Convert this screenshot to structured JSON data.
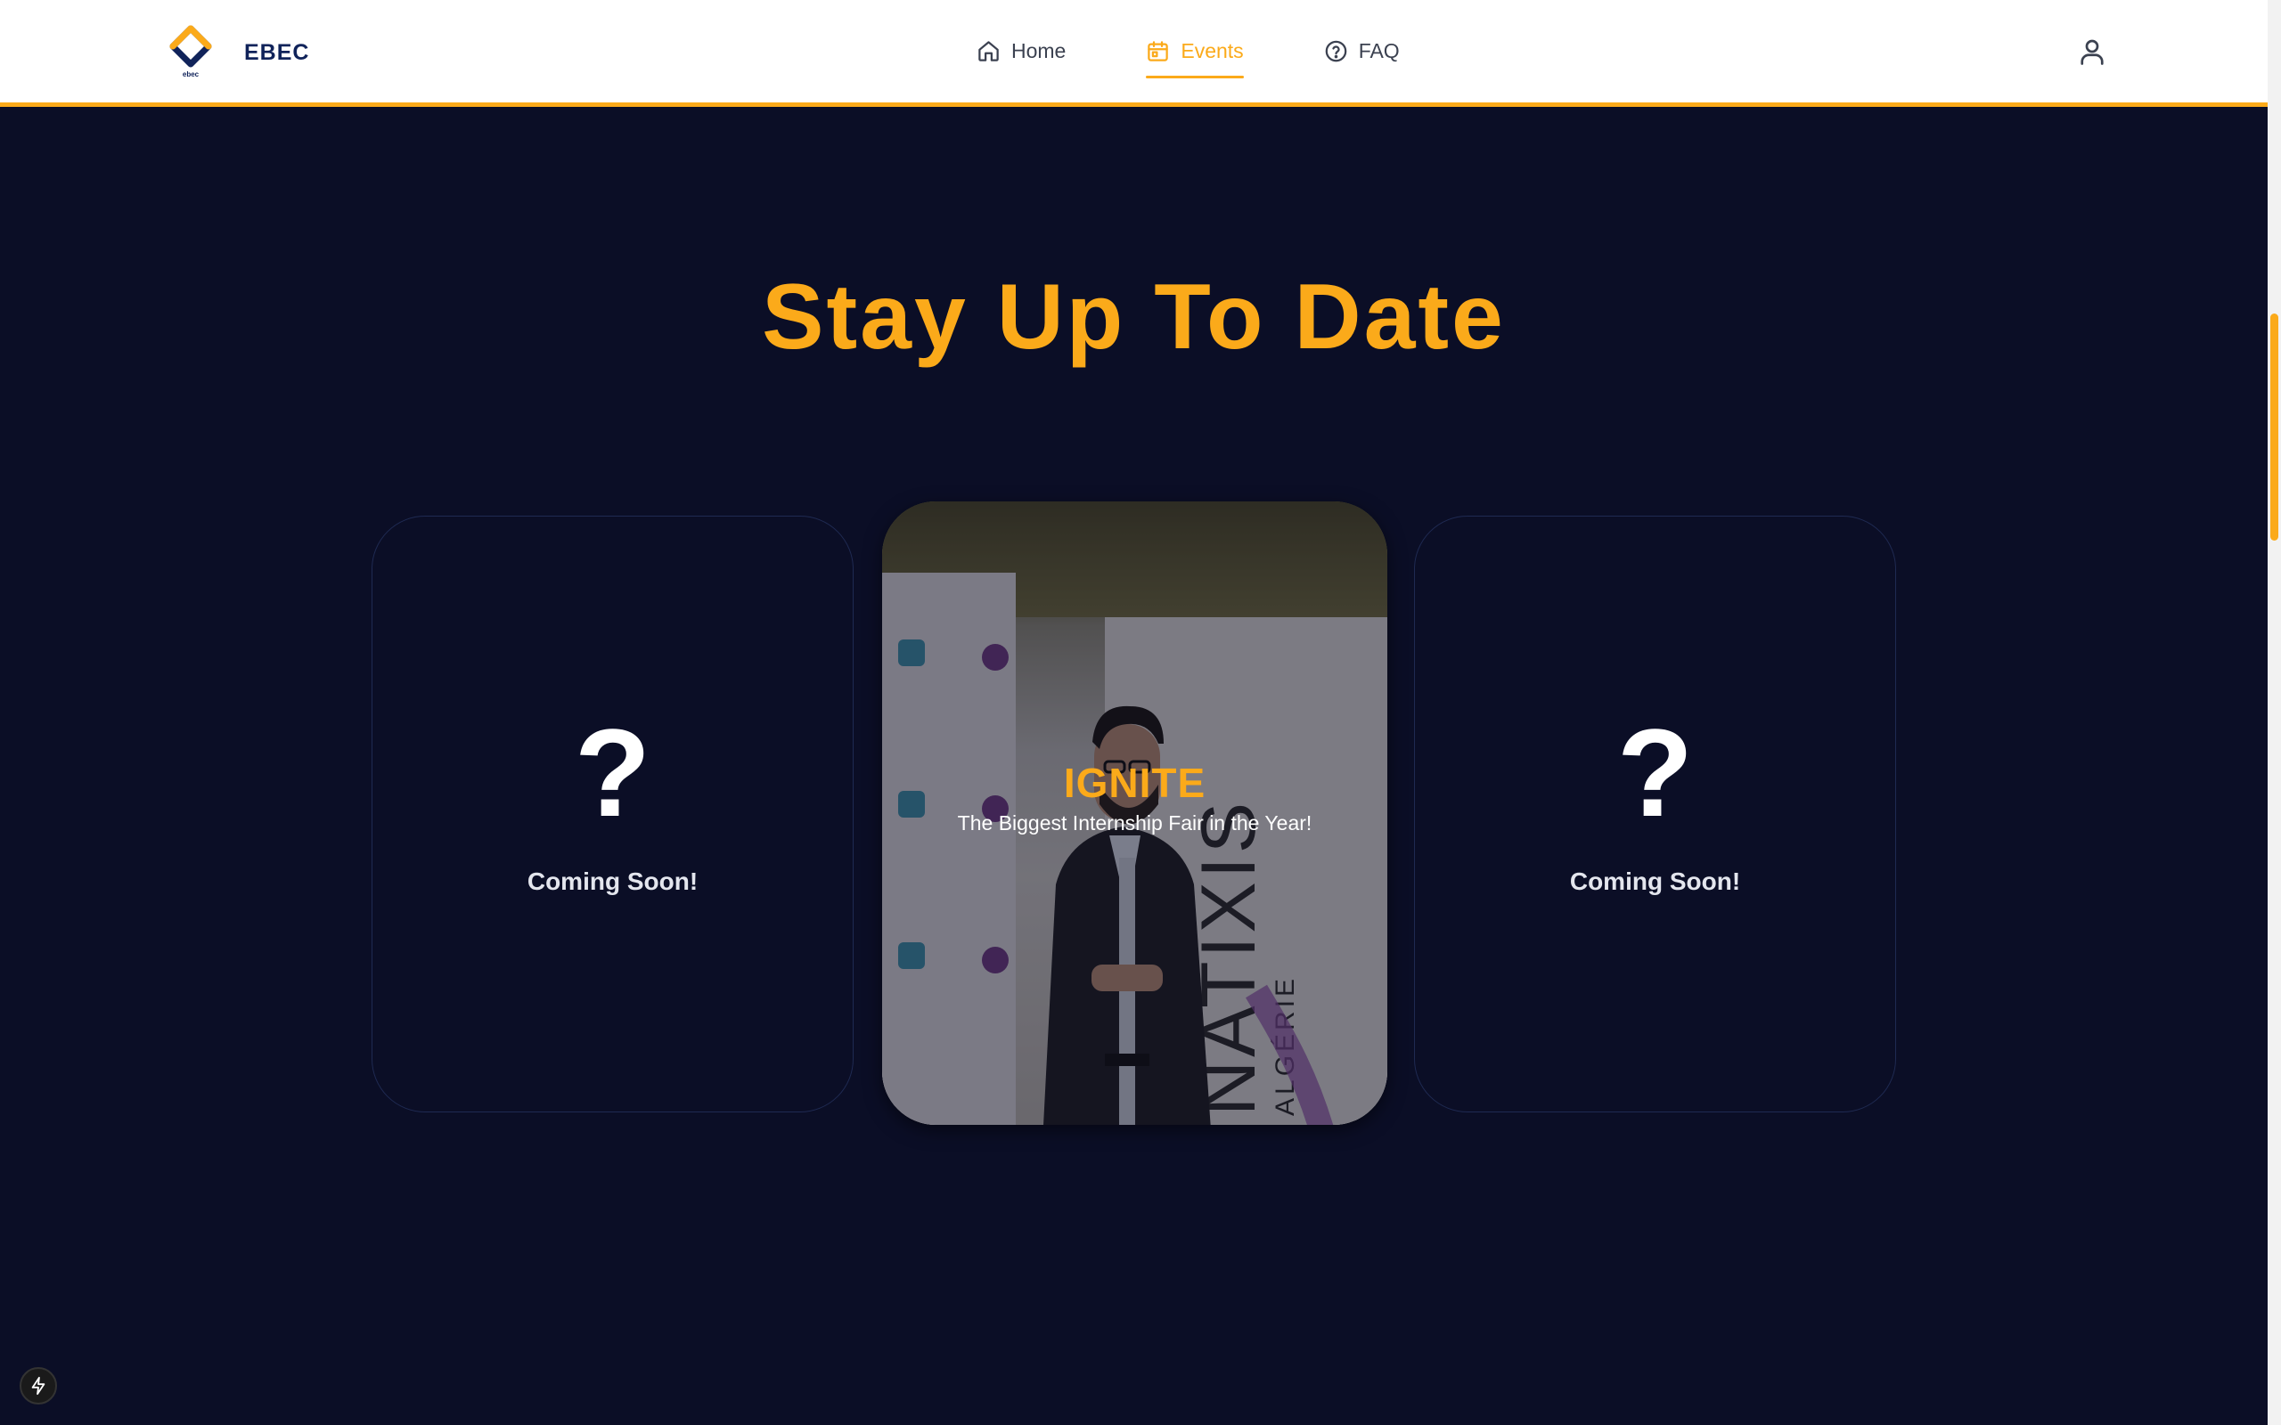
{
  "colors": {
    "background": "#0b0e26",
    "accent": "#fbaa1a",
    "navbar_bg": "#ffffff",
    "brand_text": "#10235a",
    "nav_text": "#3b4150"
  },
  "header": {
    "brand": {
      "logo_icon": "ebec-logo-icon",
      "logo_caption": "ebec",
      "name": "EBEC"
    },
    "nav": [
      {
        "label": "Home",
        "icon": "home-icon",
        "active": false
      },
      {
        "label": "Events",
        "icon": "calendar-icon",
        "active": true
      },
      {
        "label": "FAQ",
        "icon": "help-circle-icon",
        "active": false
      }
    ],
    "user_icon": "user-icon"
  },
  "main": {
    "title": "Stay Up To Date",
    "cards": [
      {
        "icon": "?",
        "label": "Coming Soon!"
      },
      {
        "title": "IGNITE",
        "subtitle": "The Biggest Internship Fair in the Year!",
        "banner_text": "NATIXIS",
        "banner_sub": "ALGÉRIE"
      },
      {
        "icon": "?",
        "label": "Coming Soon!"
      }
    ]
  },
  "dev_badge_icon": "lightning-icon"
}
